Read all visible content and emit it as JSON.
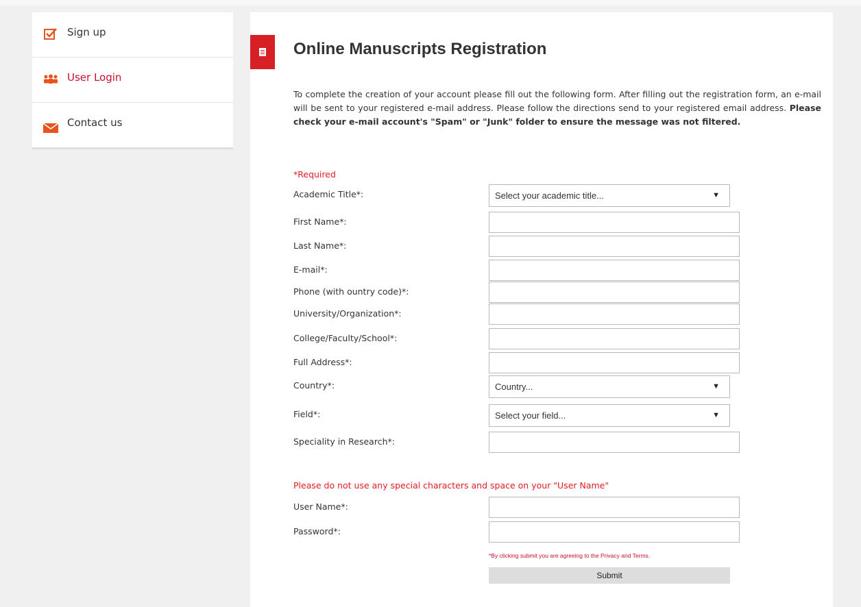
{
  "sidebar": {
    "items": [
      {
        "label": "Sign up",
        "icon": "checkbox-icon",
        "active": false
      },
      {
        "label": "User Login",
        "icon": "users-icon",
        "active": true
      },
      {
        "label": "Contact us",
        "icon": "envelope-icon",
        "active": false
      }
    ]
  },
  "colors": {
    "accent": "#d71f26",
    "required": "#e31b23",
    "link": "#c8102e"
  },
  "page": {
    "title": "Online Manuscripts Registration",
    "intro_text": "To complete the creation of your account please fill out the following form. After filling out the registration form, an e-mail will be sent to your registered e-mail address. Please follow the directions send to your registered email address. ",
    "intro_bold": "Please check your e-mail account's \"Spam\" or \"Junk\" folder to ensure the message was not filtered."
  },
  "form": {
    "required_note": "*Required",
    "fields": {
      "academic_title": {
        "label": "Academic Title*:",
        "value": "Select your academic title..."
      },
      "first_name": {
        "label": "First Name*:",
        "value": ""
      },
      "last_name": {
        "label": "Last Name*:",
        "value": ""
      },
      "email": {
        "label": "E-mail*:",
        "value": ""
      },
      "phone": {
        "label": "Phone (with ountry code)*:",
        "value": ""
      },
      "university": {
        "label": "University/Organization*:",
        "value": ""
      },
      "college": {
        "label": "College/Faculty/School*:",
        "value": ""
      },
      "address": {
        "label": "Full Address*:",
        "value": ""
      },
      "country": {
        "label": "Country*:",
        "value": "Country..."
      },
      "field": {
        "label": "Field*:",
        "value": "Select your field..."
      },
      "speciality": {
        "label": "Speciality in Research*:",
        "value": ""
      },
      "username": {
        "label": "User Name*:",
        "value": ""
      },
      "password": {
        "label": "Password*:",
        "value": ""
      }
    },
    "username_warning": "Please do not use any special characters and space on your \"User Name\"",
    "agree_text": "*By clicking submit you are agreeing to the ",
    "agree_link": "Privacy and Terms.",
    "submit_label": "Submit"
  }
}
